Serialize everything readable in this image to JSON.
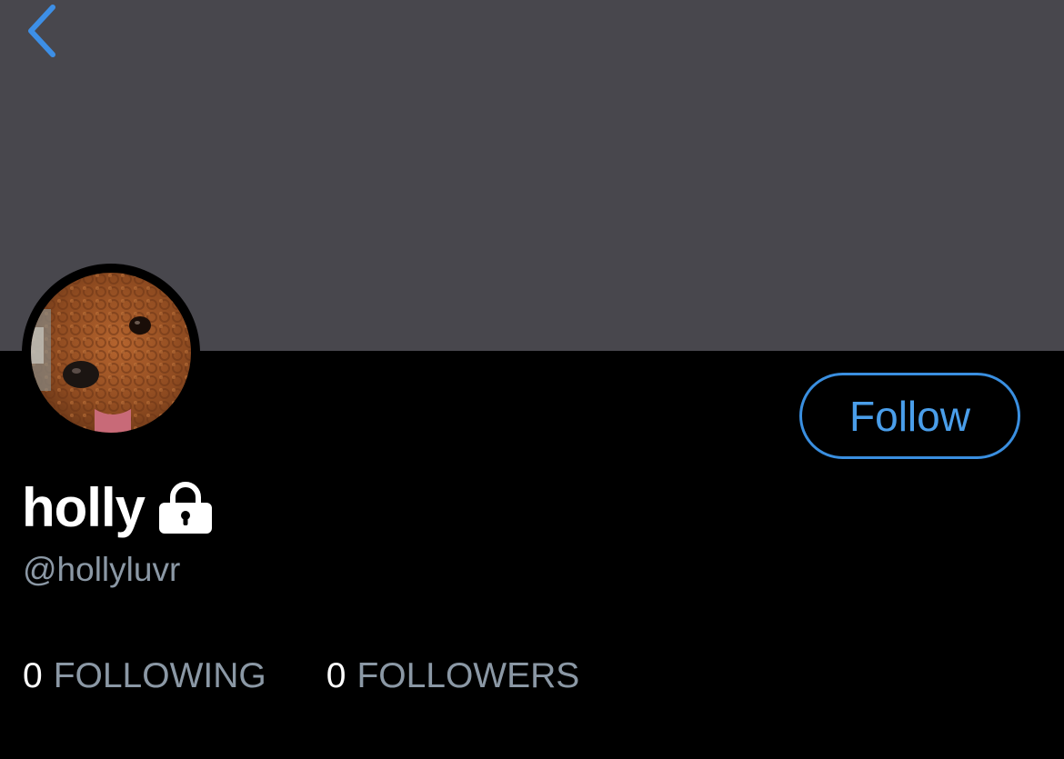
{
  "header": {
    "back_icon": "chevron-left-icon",
    "banner_color": "#48474d",
    "accent_color": "#4a9eea"
  },
  "profile": {
    "avatar_alt": "poodle avatar",
    "display_name": "holly",
    "protected_icon": "lock-icon",
    "handle": "@hollyluvr"
  },
  "actions": {
    "follow_label": "Follow"
  },
  "stats": {
    "following_count": "0",
    "following_label": "FOLLOWING",
    "followers_count": "0",
    "followers_label": "FOLLOWERS"
  }
}
